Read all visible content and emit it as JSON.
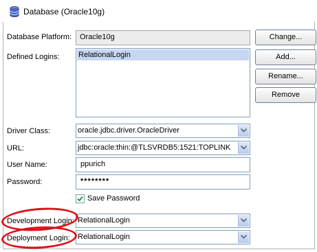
{
  "header": {
    "title": "Database (Oracle10g)",
    "icon": "database-icon"
  },
  "form": {
    "platform_label": "Database Platform:",
    "platform_value": "Oracle10g",
    "logins_label": "Defined Logins:",
    "logins": [
      "RelationalLogin"
    ],
    "driver_label": "Driver Class:",
    "driver_value": "oracle.jdbc.driver.OracleDriver",
    "url_label": "URL:",
    "url_value": "jdbc:oracle:thin:@TLSVRDB5:1521:TOPLINK",
    "user_label": "User Name:",
    "user_value": "ppurich",
    "password_label": "Password:",
    "password_value": "********",
    "save_password_label": "Save Password",
    "save_password_checked": true,
    "dev_login_label": "Development Login:",
    "dev_login_value": "RelationalLogin",
    "deploy_login_label": "Deployment Login:",
    "deploy_login_value": "RelationalLogin"
  },
  "buttons": {
    "change": "Change...",
    "add": "Add...",
    "rename": "Rename...",
    "remove": "Remove"
  },
  "colors": {
    "highlight_ring": "#e0101a",
    "selection": "#c7d7f2"
  }
}
